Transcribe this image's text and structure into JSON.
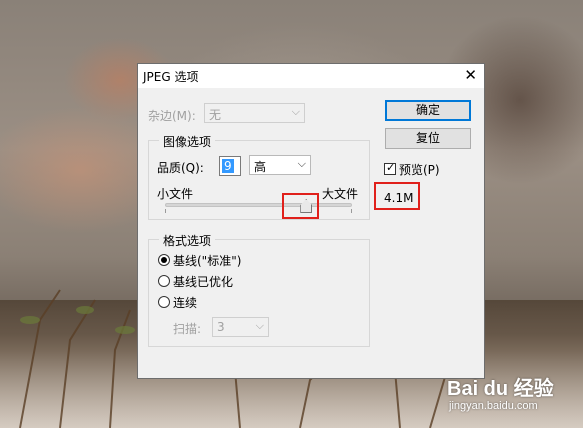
{
  "dialog": {
    "title": "JPEG 选项",
    "matte_label": "杂边(M):",
    "matte_value": "无",
    "quality_group_title": "图像选项",
    "quality_label": "品质(Q):",
    "quality_value": "9",
    "quality_preset": "高",
    "slider_min_label": "小文件",
    "slider_max_label": "大文件",
    "quality_level_fraction": 0.75,
    "format_group_title": "格式选项",
    "format_options": [
      {
        "label": "基线(\"标准\")",
        "selected": true
      },
      {
        "label": "基线已优化",
        "selected": false
      },
      {
        "label": "连续",
        "selected": false
      }
    ],
    "scan_label": "扫描:",
    "scan_value": "3",
    "ok_label": "确定",
    "reset_label": "复位",
    "preview_label": "预览(P)",
    "preview_checked": true,
    "file_size": "4.1M"
  },
  "colors": {
    "highlight": "#e0201b",
    "default_button_border": "#0078d7"
  },
  "watermark": {
    "logo": "Bai du 经验",
    "url": "jingyan.baidu.com"
  }
}
